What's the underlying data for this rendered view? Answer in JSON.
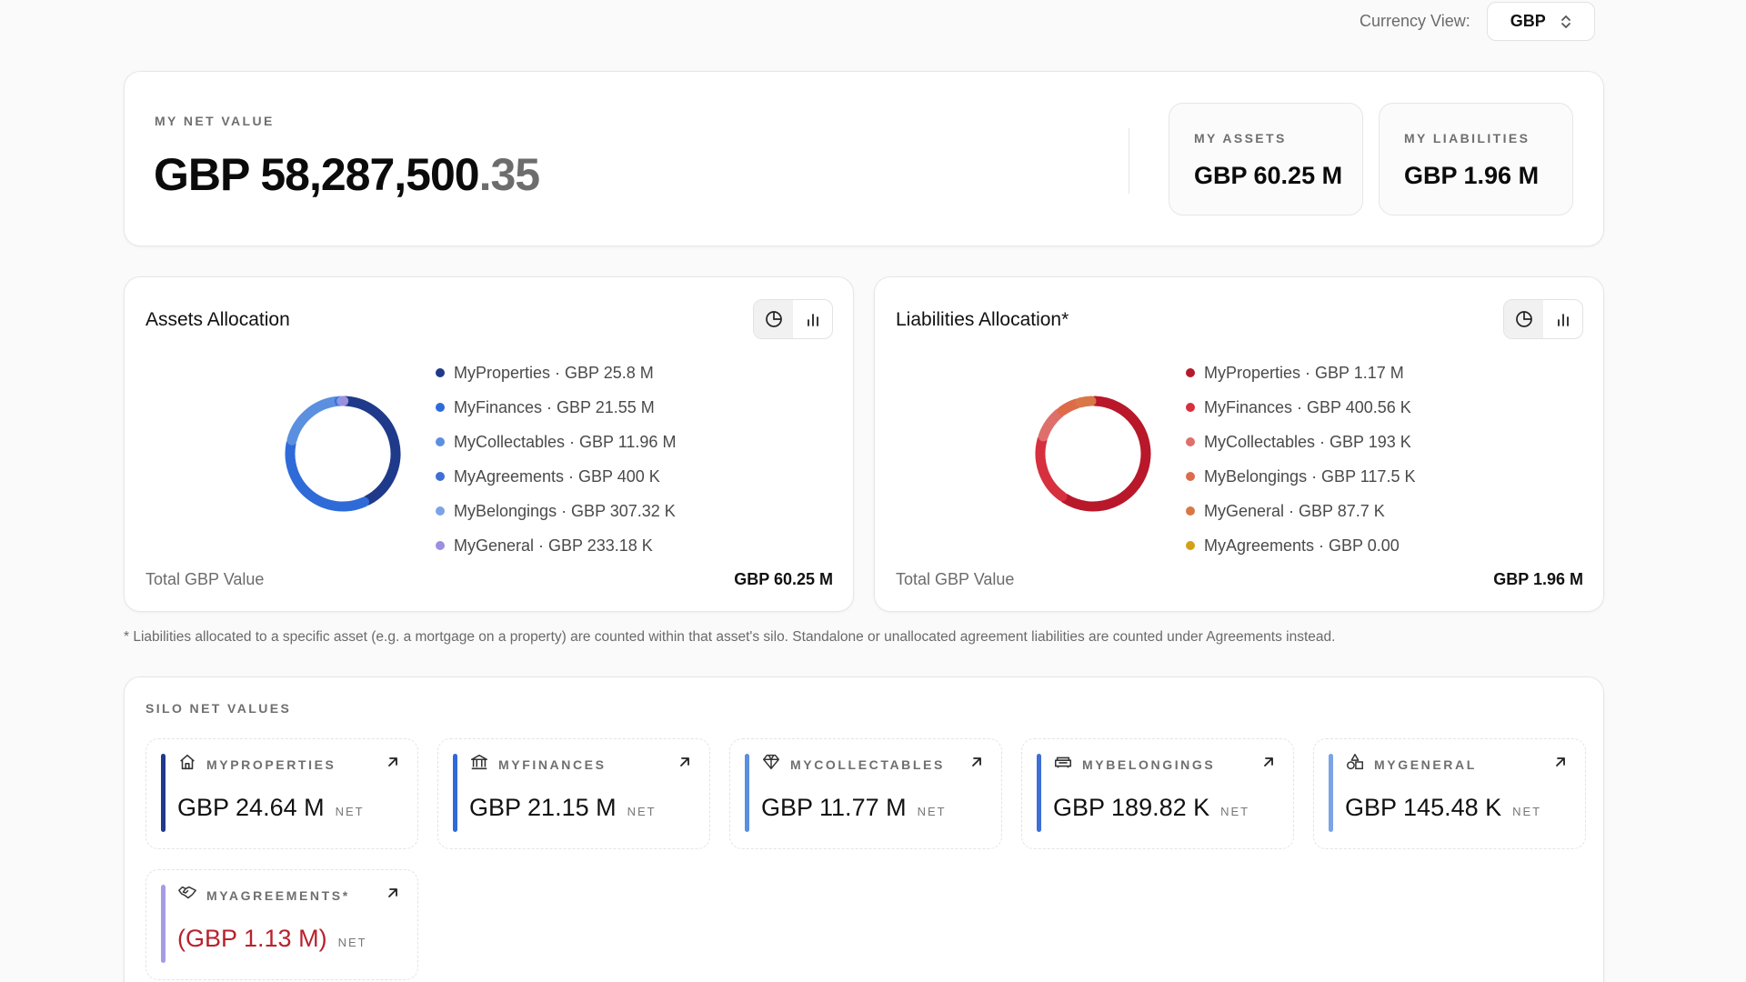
{
  "currency": {
    "label": "Currency View:",
    "selected": "GBP"
  },
  "net": {
    "eyebrow": "MY NET VALUE",
    "value_main": "GBP 58,287,500",
    "value_cents": ".35",
    "assets": {
      "label": "MY ASSETS",
      "value": "GBP 60.25 M"
    },
    "liabilities": {
      "label": "MY LIABILITIES",
      "value": "GBP 1.96 M"
    }
  },
  "assets_alloc": {
    "title": "Assets Allocation",
    "total_label": "Total GBP Value",
    "total_value": "GBP 60.25 M",
    "legend": [
      {
        "label": "MyProperties · GBP 25.8 M",
        "color": "#1f3a8a"
      },
      {
        "label": "MyFinances · GBP 21.55 M",
        "color": "#2f6bd8"
      },
      {
        "label": "MyCollectables · GBP 11.96 M",
        "color": "#5b8fe0"
      },
      {
        "label": "MyAgreements · GBP 400 K",
        "color": "#3d6fd6"
      },
      {
        "label": "MyBelongings · GBP 307.32 K",
        "color": "#7ba3e6"
      },
      {
        "label": "MyGeneral · GBP 233.18 K",
        "color": "#9a8fe0"
      }
    ]
  },
  "liab_alloc": {
    "title": "Liabilities Allocation*",
    "total_label": "Total GBP Value",
    "total_value": "GBP 1.96 M",
    "legend": [
      {
        "label": "MyProperties · GBP 1.17 M",
        "color": "#b8182a"
      },
      {
        "label": "MyFinances · GBP 400.56 K",
        "color": "#d6303f"
      },
      {
        "label": "MyCollectables · GBP 193 K",
        "color": "#de6f6a"
      },
      {
        "label": "MyBelongings · GBP 117.5 K",
        "color": "#dd6b4a"
      },
      {
        "label": "MyGeneral · GBP 87.7 K",
        "color": "#d97746"
      },
      {
        "label": "MyAgreements · GBP 0.00",
        "color": "#d4a017"
      }
    ]
  },
  "chart_data": [
    {
      "type": "pie",
      "title": "Assets Allocation",
      "categories": [
        "MyProperties",
        "MyFinances",
        "MyCollectables",
        "MyAgreements",
        "MyBelongings",
        "MyGeneral"
      ],
      "values": [
        25.8,
        21.55,
        11.96,
        0.4,
        0.30732,
        0.23318
      ],
      "unit": "GBP M",
      "colors": [
        "#1f3a8a",
        "#2f6bd8",
        "#5b8fe0",
        "#3d6fd6",
        "#7ba3e6",
        "#9a8fe0"
      ]
    },
    {
      "type": "pie",
      "title": "Liabilities Allocation*",
      "categories": [
        "MyProperties",
        "MyFinances",
        "MyCollectables",
        "MyBelongings",
        "MyGeneral",
        "MyAgreements"
      ],
      "values": [
        1.17,
        0.40056,
        0.193,
        0.1175,
        0.0877,
        0.0
      ],
      "unit": "GBP M",
      "colors": [
        "#b8182a",
        "#d6303f",
        "#de6f6a",
        "#dd6b4a",
        "#d97746",
        "#d4a017"
      ]
    }
  ],
  "footnote": "* Liabilities allocated to a specific asset (e.g. a mortgage on a property) are counted within that asset's silo. Standalone or unallocated agreement liabilities are counted under Agreements instead.",
  "silos": {
    "eyebrow": "SILO NET VALUES",
    "net_tag": "NET",
    "items": [
      {
        "label": "MYPROPERTIES",
        "value": "GBP 24.64 M",
        "icon": "home-icon",
        "color": "#1f3a8a",
        "negative": false
      },
      {
        "label": "MYFINANCES",
        "value": "GBP 21.15 M",
        "icon": "bank-icon",
        "color": "#2f6bd8",
        "negative": false
      },
      {
        "label": "MYCOLLECTABLES",
        "value": "GBP 11.77 M",
        "icon": "diamond-icon",
        "color": "#5b8fe0",
        "negative": false
      },
      {
        "label": "MYBELONGINGS",
        "value": "GBP 189.82 K",
        "icon": "sofa-icon",
        "color": "#3d6fd6",
        "negative": false
      },
      {
        "label": "MYGENERAL",
        "value": "GBP 145.48 K",
        "icon": "shapes-icon",
        "color": "#7ba3e6",
        "negative": false
      },
      {
        "label": "MYAGREEMENTS*",
        "value": "(GBP 1.13 M)",
        "icon": "handshake-icon",
        "color": "#a59ce6",
        "negative": true
      }
    ]
  }
}
